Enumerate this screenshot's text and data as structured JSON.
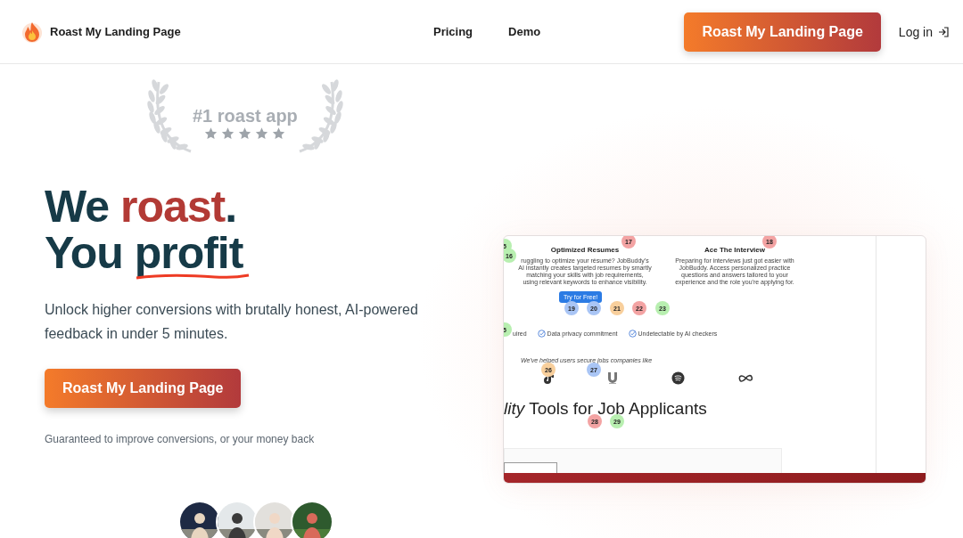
{
  "header": {
    "brand": "Roast My Landing Page",
    "nav": [
      "Pricing",
      "Demo"
    ],
    "cta": "Roast My Landing Page",
    "login": "Log in"
  },
  "award": {
    "label": "#1 roast app",
    "stars": 5
  },
  "hero": {
    "headline": [
      [
        {
          "text": "We ",
          "kind": "plain"
        },
        {
          "text": "roast",
          "kind": "accent"
        },
        {
          "text": ".",
          "kind": "plain"
        }
      ],
      [
        {
          "text": "You ",
          "kind": "plain"
        },
        {
          "text": "profit",
          "kind": "underline"
        }
      ]
    ],
    "subtitle": "Unlock higher conversions with brutally honest, AI-powered feedback in under 5 minutes.",
    "cta": "Roast My Landing Page",
    "guarantee": "Guaranteed to improve conversions, or your money back",
    "avatars": [
      {
        "kind": "picture"
      },
      {
        "kind": "picture"
      },
      {
        "kind": "picture"
      },
      {
        "kind": "picture"
      }
    ]
  },
  "preview": {
    "features": [
      {
        "title": "Optimized Resumes",
        "text": "ruggling to optimize your résumé? JobBuddy's AI instantly creates targeted resumes by smartly matching your skills with job requirements, using relevant keywords to enhance visibility."
      },
      {
        "title": "Ace The Interview",
        "text": "Preparing for interviews just got easier with JobBuddy. Access personalized practice questions and answers tailored to your experience and the role you're applying for."
      }
    ],
    "button": "Try for Free!",
    "checks": [
      "uired",
      "Data privacy commitment",
      "Undetectable by AI checkers"
    ],
    "companies_caption": "We've helped users secure jobs companies like",
    "heading": "*lity* Tools for Job Applicants",
    "badges": [
      {
        "label": "5",
        "color": "#b8efb0"
      },
      {
        "label": "16",
        "color": "#b8efb0"
      },
      {
        "label": "17",
        "color": "#f3a3a3"
      },
      {
        "label": "18",
        "color": "#f3a3a3"
      },
      {
        "label": "19",
        "color": "#a9c5f5"
      },
      {
        "label": "20",
        "color": "#a9c5f5"
      },
      {
        "label": "21",
        "color": "#f8cf9c"
      },
      {
        "label": "22",
        "color": "#f3a3a3"
      },
      {
        "label": "23",
        "color": "#b8efb0"
      },
      {
        "label": "5",
        "color": "#b8efb0"
      },
      {
        "label": "26",
        "color": "#f8cf9c"
      },
      {
        "label": "27",
        "color": "#a9c5f5"
      },
      {
        "label": "28",
        "color": "#f3a3a3"
      },
      {
        "label": "29",
        "color": "#b8efb0"
      }
    ]
  }
}
